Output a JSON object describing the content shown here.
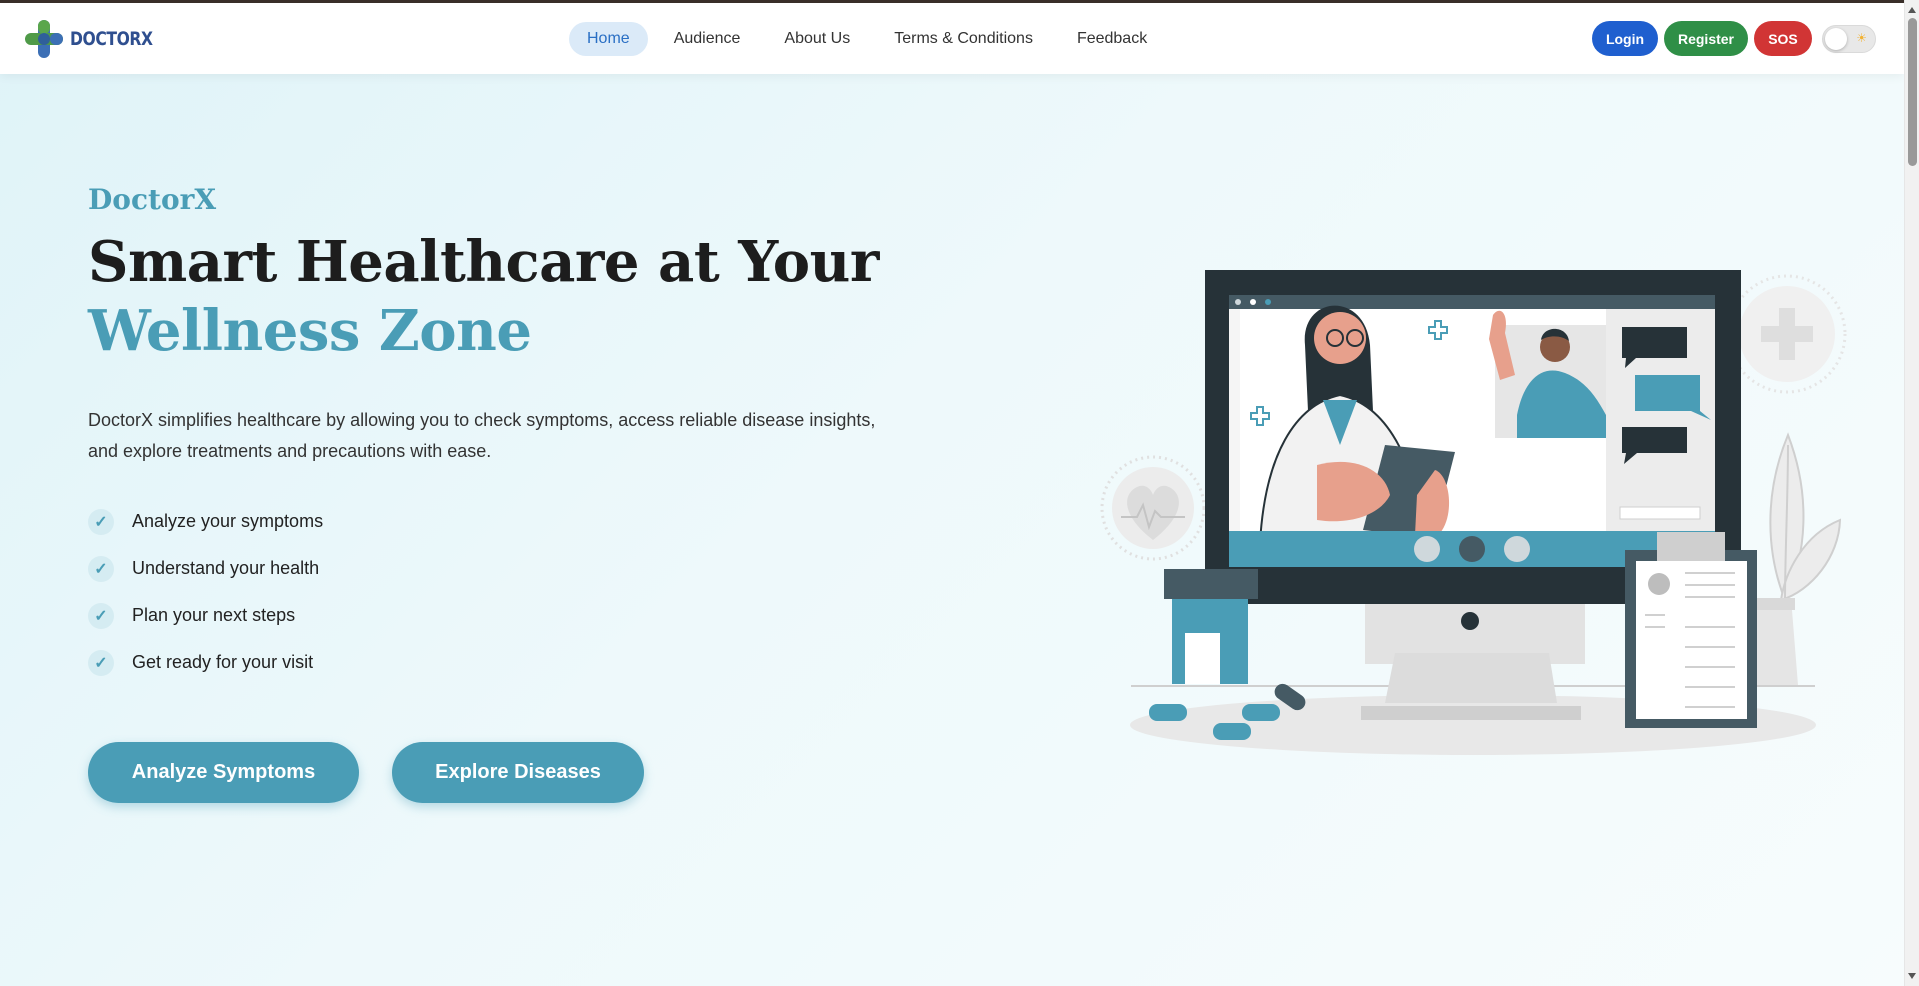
{
  "nav": {
    "brand": "DOCTORX",
    "links": [
      "Home",
      "Audience",
      "About Us",
      "Terms & Conditions",
      "Feedback"
    ],
    "active": "Home",
    "login": "Login",
    "register": "Register",
    "sos": "SOS",
    "theme_toggle_icon": "sun-icon"
  },
  "hero": {
    "brand": "DoctorX",
    "title_line1": "Smart Healthcare at Your",
    "title_line2": "Wellness Zone",
    "description": "DoctorX simplifies healthcare by allowing you to check symptoms, access reliable disease insights, and explore treatments and precautions with ease.",
    "features": [
      "Analyze your symptoms",
      "Understand your health",
      "Plan your next steps",
      "Get ready for your visit"
    ],
    "check_icon": "check-icon",
    "cta_primary": "Analyze Symptoms",
    "cta_secondary": "Explore Diseases"
  },
  "colors": {
    "accent": "#4a9db6",
    "login": "#1f5fcf",
    "register": "#2f8f47",
    "sos": "#d13535",
    "brand_text": "#2f4f8f"
  }
}
